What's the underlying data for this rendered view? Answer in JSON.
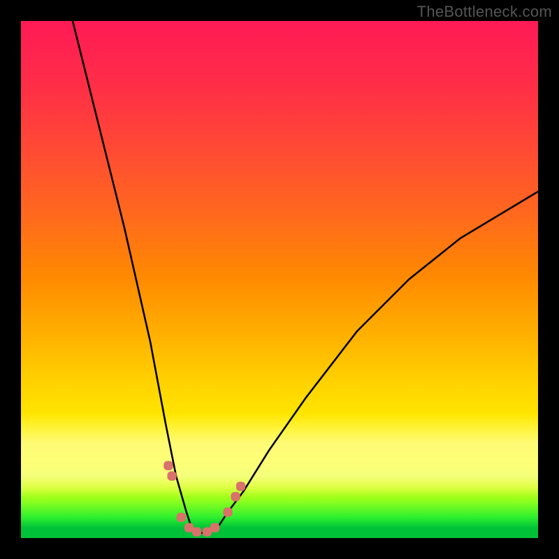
{
  "watermark": "TheBottleneck.com",
  "chart_data": {
    "type": "line",
    "title": "",
    "xlabel": "",
    "ylabel": "",
    "xlim": [
      0,
      100
    ],
    "ylim": [
      0,
      100
    ],
    "series": [
      {
        "name": "bottleneck-curve",
        "x": [
          10,
          15,
          20,
          25,
          28,
          30,
          32,
          33,
          34,
          35,
          36,
          38,
          40,
          43,
          48,
          55,
          65,
          75,
          85,
          95,
          100
        ],
        "values": [
          100,
          80,
          60,
          38,
          22,
          12,
          5,
          2,
          1,
          1,
          1,
          2,
          5,
          9,
          17,
          27,
          40,
          50,
          58,
          64,
          67
        ]
      }
    ],
    "markers": {
      "name": "bottleneck-markers",
      "x": [
        28.5,
        29.2,
        31,
        32.5,
        34,
        36,
        37.5,
        40,
        41.5,
        42.5
      ],
      "values": [
        14,
        12,
        4,
        2,
        1.2,
        1.2,
        2,
        5,
        8,
        10
      ]
    },
    "background_gradient": {
      "bottom": "#00c238",
      "mid_green": "#2ef02e",
      "chartreuse": "#d4ff14",
      "yellow": "#fff200",
      "orange": "#ff8b00",
      "red": "#ff1a55"
    }
  }
}
